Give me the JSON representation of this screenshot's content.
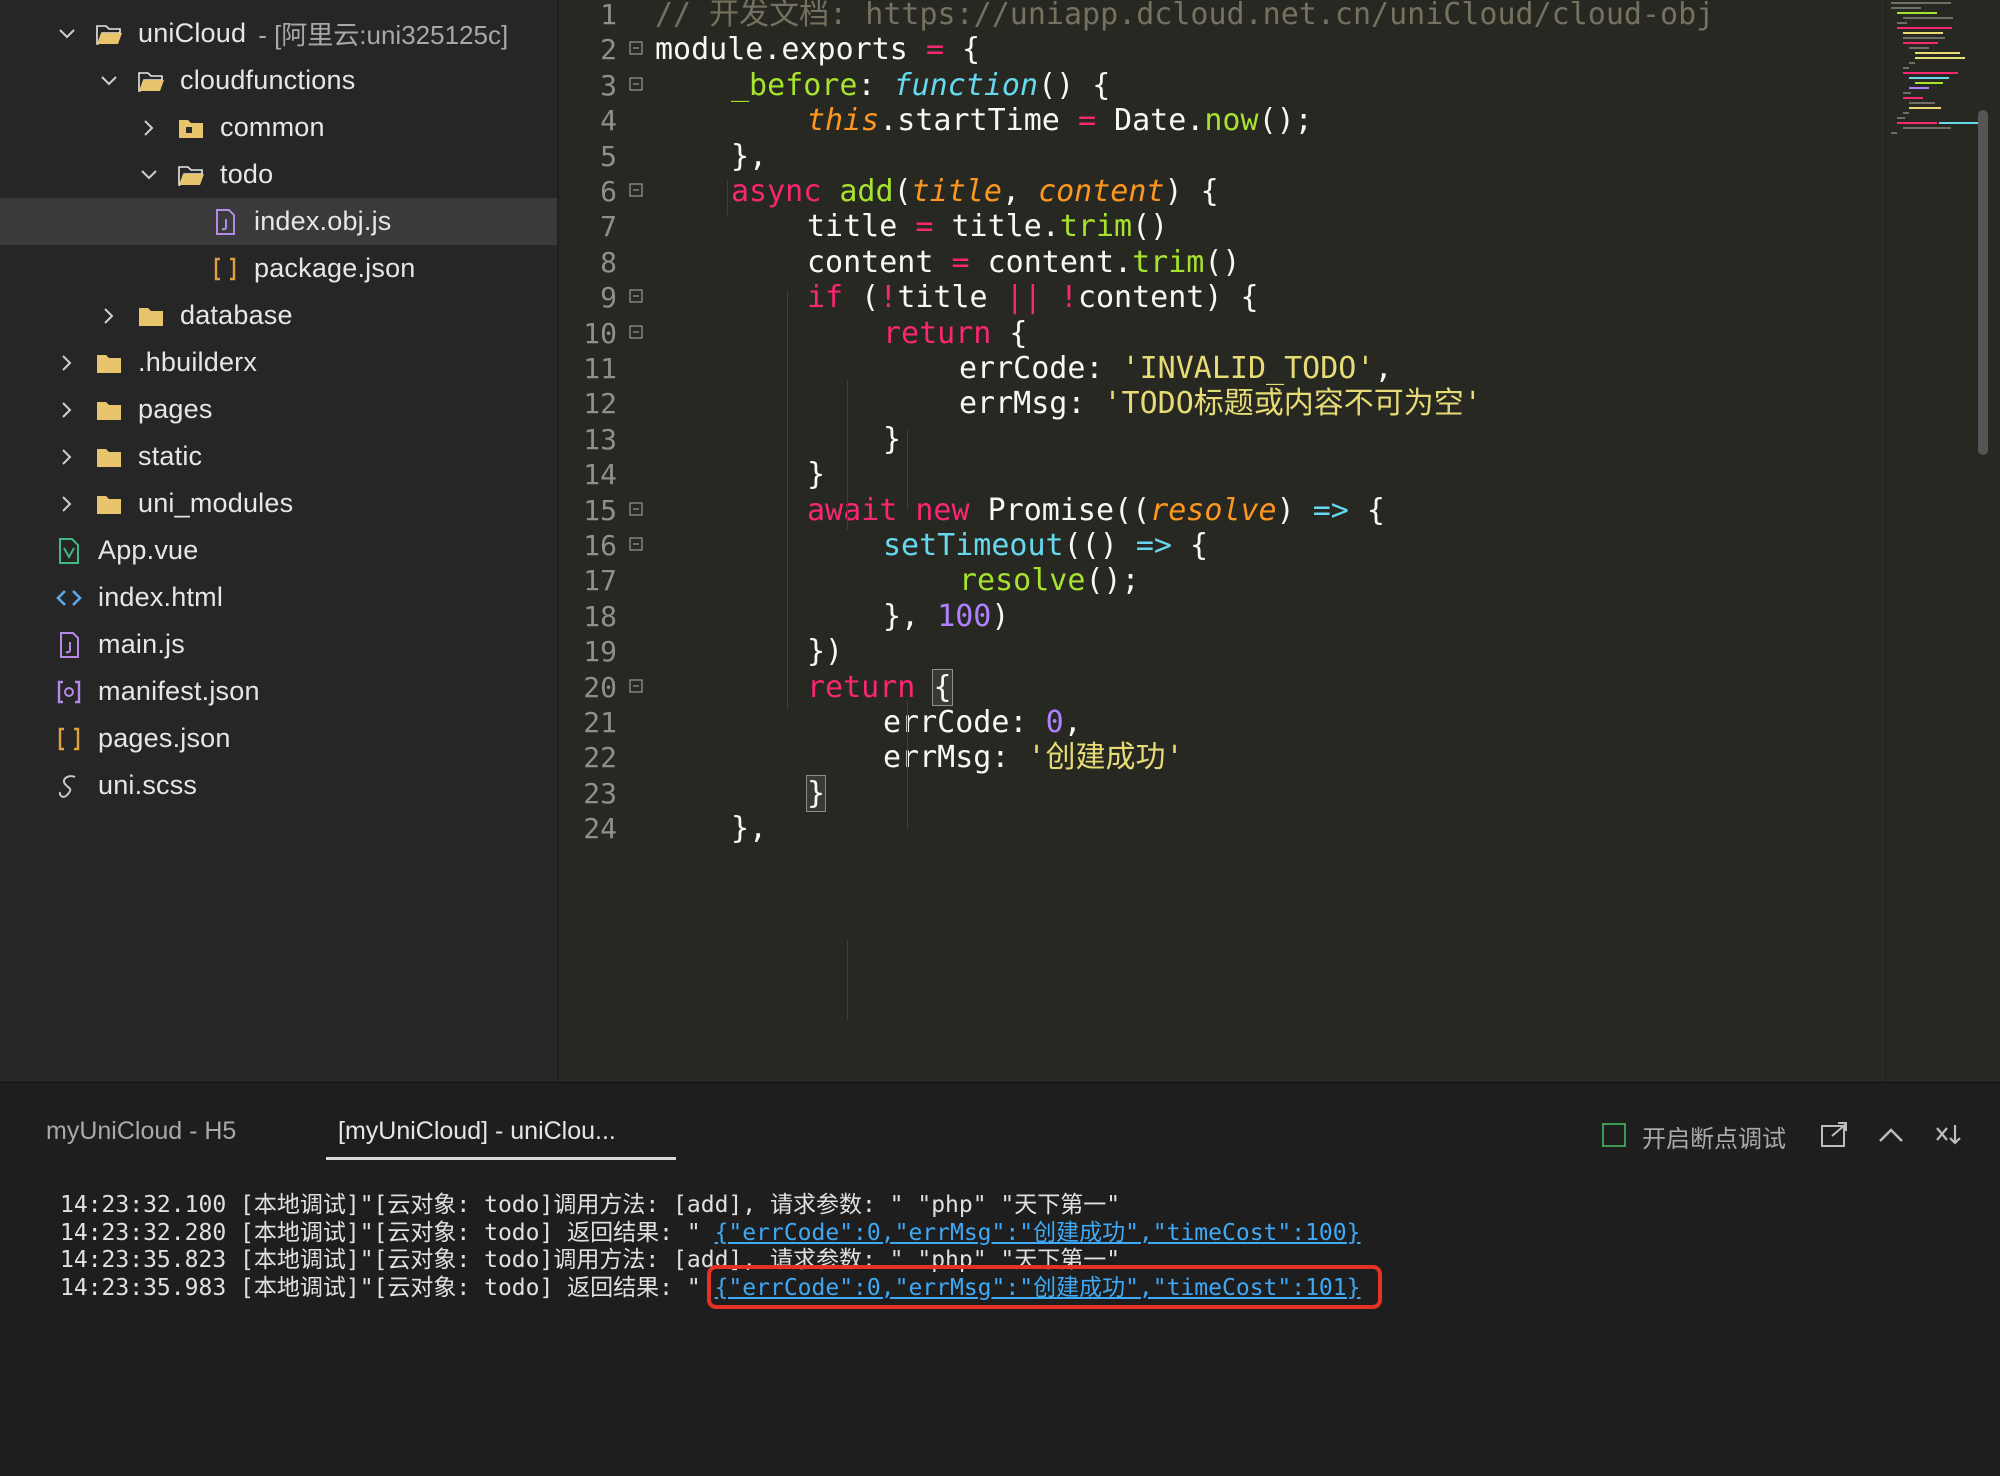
{
  "sidebar": {
    "items": [
      {
        "label": "uniCloud",
        "sub": "- [阿里云:uni325125c]",
        "icon": "folder-open-icon",
        "chevron": "down"
      },
      {
        "label": "cloudfunctions",
        "icon": "folder-open-icon",
        "chevron": "down"
      },
      {
        "label": "common",
        "icon": "folder-special-icon",
        "chevron": "right"
      },
      {
        "label": "todo",
        "icon": "folder-open-icon",
        "chevron": "down"
      },
      {
        "label": "index.obj.js",
        "icon": "js-file-icon",
        "chevron": "none",
        "selected": true
      },
      {
        "label": "package.json",
        "icon": "json-file-icon",
        "chevron": "none"
      },
      {
        "label": "database",
        "icon": "folder-icon",
        "chevron": "right"
      },
      {
        "label": ".hbuilderx",
        "icon": "folder-icon",
        "chevron": "right"
      },
      {
        "label": "pages",
        "icon": "folder-icon",
        "chevron": "right"
      },
      {
        "label": "static",
        "icon": "folder-icon",
        "chevron": "right"
      },
      {
        "label": "uni_modules",
        "icon": "folder-icon",
        "chevron": "right"
      },
      {
        "label": "App.vue",
        "icon": "vue-file-icon",
        "chevron": "none"
      },
      {
        "label": "index.html",
        "icon": "html-file-icon",
        "chevron": "none"
      },
      {
        "label": "main.js",
        "icon": "js-file-icon",
        "chevron": "none"
      },
      {
        "label": "manifest.json",
        "icon": "manifest-file-icon",
        "chevron": "none"
      },
      {
        "label": "pages.json",
        "icon": "json-file-icon",
        "chevron": "none"
      },
      {
        "label": "uni.scss",
        "icon": "scss-file-icon",
        "chevron": "none"
      }
    ]
  },
  "editor": {
    "lines": [
      {
        "n": "1",
        "fold": false
      },
      {
        "n": "2",
        "fold": true
      },
      {
        "n": "3",
        "fold": true
      },
      {
        "n": "4",
        "fold": false
      },
      {
        "n": "5",
        "fold": false
      },
      {
        "n": "6",
        "fold": true
      },
      {
        "n": "7",
        "fold": false
      },
      {
        "n": "8",
        "fold": false
      },
      {
        "n": "9",
        "fold": true
      },
      {
        "n": "10",
        "fold": true
      },
      {
        "n": "11",
        "fold": false
      },
      {
        "n": "12",
        "fold": false
      },
      {
        "n": "13",
        "fold": false
      },
      {
        "n": "14",
        "fold": false
      },
      {
        "n": "15",
        "fold": true
      },
      {
        "n": "16",
        "fold": true
      },
      {
        "n": "17",
        "fold": false
      },
      {
        "n": "18",
        "fold": false
      },
      {
        "n": "19",
        "fold": false
      },
      {
        "n": "20",
        "fold": true
      },
      {
        "n": "21",
        "fold": false
      },
      {
        "n": "22",
        "fold": false
      },
      {
        "n": "23",
        "fold": false
      },
      {
        "n": "24",
        "fold": false
      }
    ],
    "tokens": {
      "l1": [
        "// 开发文档: https://uniapp.dcloud.net.cn/uniCloud/cloud-obj"
      ],
      "l2": [
        "module",
        ".exports ",
        "=",
        " {"
      ],
      "l3": [
        "_before",
        ": ",
        "function",
        "() {"
      ],
      "l4": [
        "this",
        ".startTime ",
        "=",
        " Date.",
        "now",
        "();"
      ],
      "l5": [
        "},"
      ],
      "l6": [
        "async",
        " ",
        "add",
        "(",
        "title",
        ", ",
        "content",
        ") {"
      ],
      "l7": [
        "title ",
        "=",
        " title.",
        "trim",
        "()"
      ],
      "l8": [
        "content ",
        "=",
        " content.",
        "trim",
        "()"
      ],
      "l9": [
        "if",
        " (",
        "!",
        "title ",
        "||",
        " ",
        "!",
        "content) {"
      ],
      "l10": [
        "return",
        " {"
      ],
      "l11": [
        "errCode: ",
        "'INVALID_TODO'",
        ","
      ],
      "l12": [
        "errMsg: ",
        "'TODO标题或内容不可为空'"
      ],
      "l13": [
        "}"
      ],
      "l14": [
        "}"
      ],
      "l15": [
        "await",
        " ",
        "new",
        " Promise((",
        "resolve",
        ") ",
        "=>",
        " {"
      ],
      "l16": [
        "setTimeout",
        "(() ",
        "=>",
        " {"
      ],
      "l17": [
        "resolve",
        "();"
      ],
      "l18": [
        "}, ",
        "100",
        ")"
      ],
      "l19": [
        "})"
      ],
      "l20": [
        "return",
        " ",
        "{"
      ],
      "l21": [
        "errCode: ",
        "0",
        ","
      ],
      "l22": [
        "errMsg: ",
        "'创建成功'"
      ],
      "l23": [
        "}"
      ],
      "l24": [
        "},"
      ]
    }
  },
  "console": {
    "tabs": [
      "myUniCloud - H5",
      "[myUniCloud] - uniClou..."
    ],
    "breakpoint_label": "开启断点调试",
    "logs": [
      {
        "prefix": "14:23:32.100 [本地调试]\"[云对象: todo]调用方法: [add], 请求参数: \" \"php\" \"天下第一\"",
        "link": ""
      },
      {
        "prefix": "14:23:32.280 [本地调试]\"[云对象: todo] 返回结果: \" ",
        "link": "{\"errCode\":0,\"errMsg\":\"创建成功\",\"timeCost\":100}"
      },
      {
        "prefix": "14:23:35.823 [本地调试]\"[云对象: todo]调用方法: [add], 请求参数: \" \"php\" \"天下第一\"",
        "link": ""
      },
      {
        "prefix": "14:23:35.983 [本地调试]\"[云对象: todo] 返回结果: \" ",
        "link": "{\"errCode\":0,\"errMsg\":\"创建成功\",\"timeCost\":101}"
      }
    ]
  },
  "colors": {
    "keyword": "#f92672",
    "function": "#a6e22e",
    "string": "#e6db74",
    "number": "#ae81ff",
    "param": "#fd971f",
    "link": "#3fa9f5",
    "highlight": "#e53224"
  }
}
